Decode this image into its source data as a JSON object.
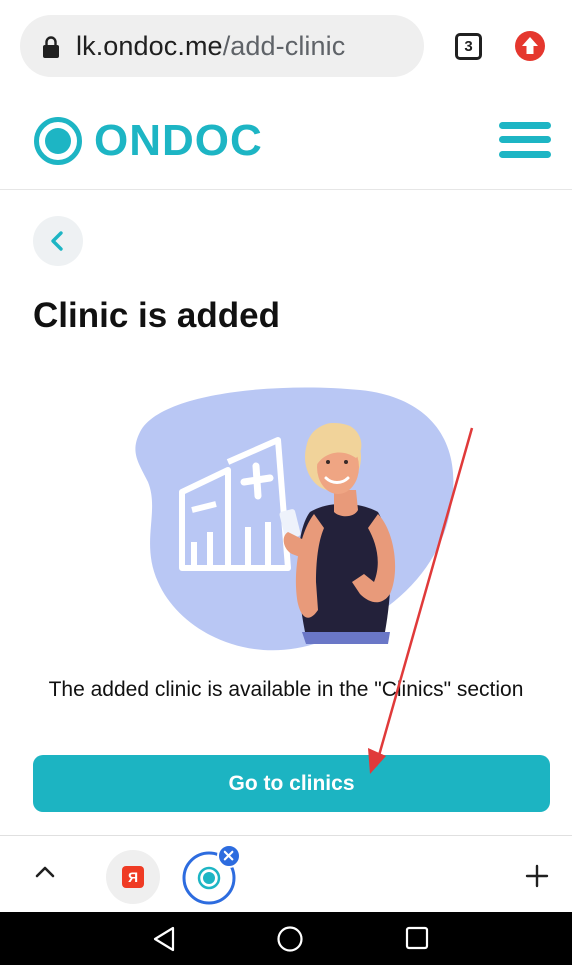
{
  "browser": {
    "url_domain": "lk.ondoc.me",
    "url_path": "/add-clinic",
    "tab_count": "3",
    "icons": {
      "lock": "lock-icon",
      "update": "update-arrow-icon",
      "tabs": "tabs-count-icon"
    },
    "bottom_bar": {
      "yandex_badge": "Я",
      "icons": [
        "chevron-up-icon",
        "yandex-tab-icon",
        "ondoc-tab-icon",
        "close-tab-icon",
        "plus-icon"
      ]
    }
  },
  "site": {
    "logo_text": "ONDOC",
    "brand_color": "#1db5c4"
  },
  "page": {
    "title": "Clinic is added",
    "info": "The added clinic is available in the \"Clinics\" section",
    "cta_label": "Go to clinics"
  },
  "system_nav": {
    "icons": [
      "back-triangle-icon",
      "home-circle-icon",
      "recents-square-icon"
    ]
  },
  "colors": {
    "accent": "#1cb4c2",
    "annotation_arrow": "#e03a3a",
    "illustration_blob": "#b9c7f4"
  }
}
